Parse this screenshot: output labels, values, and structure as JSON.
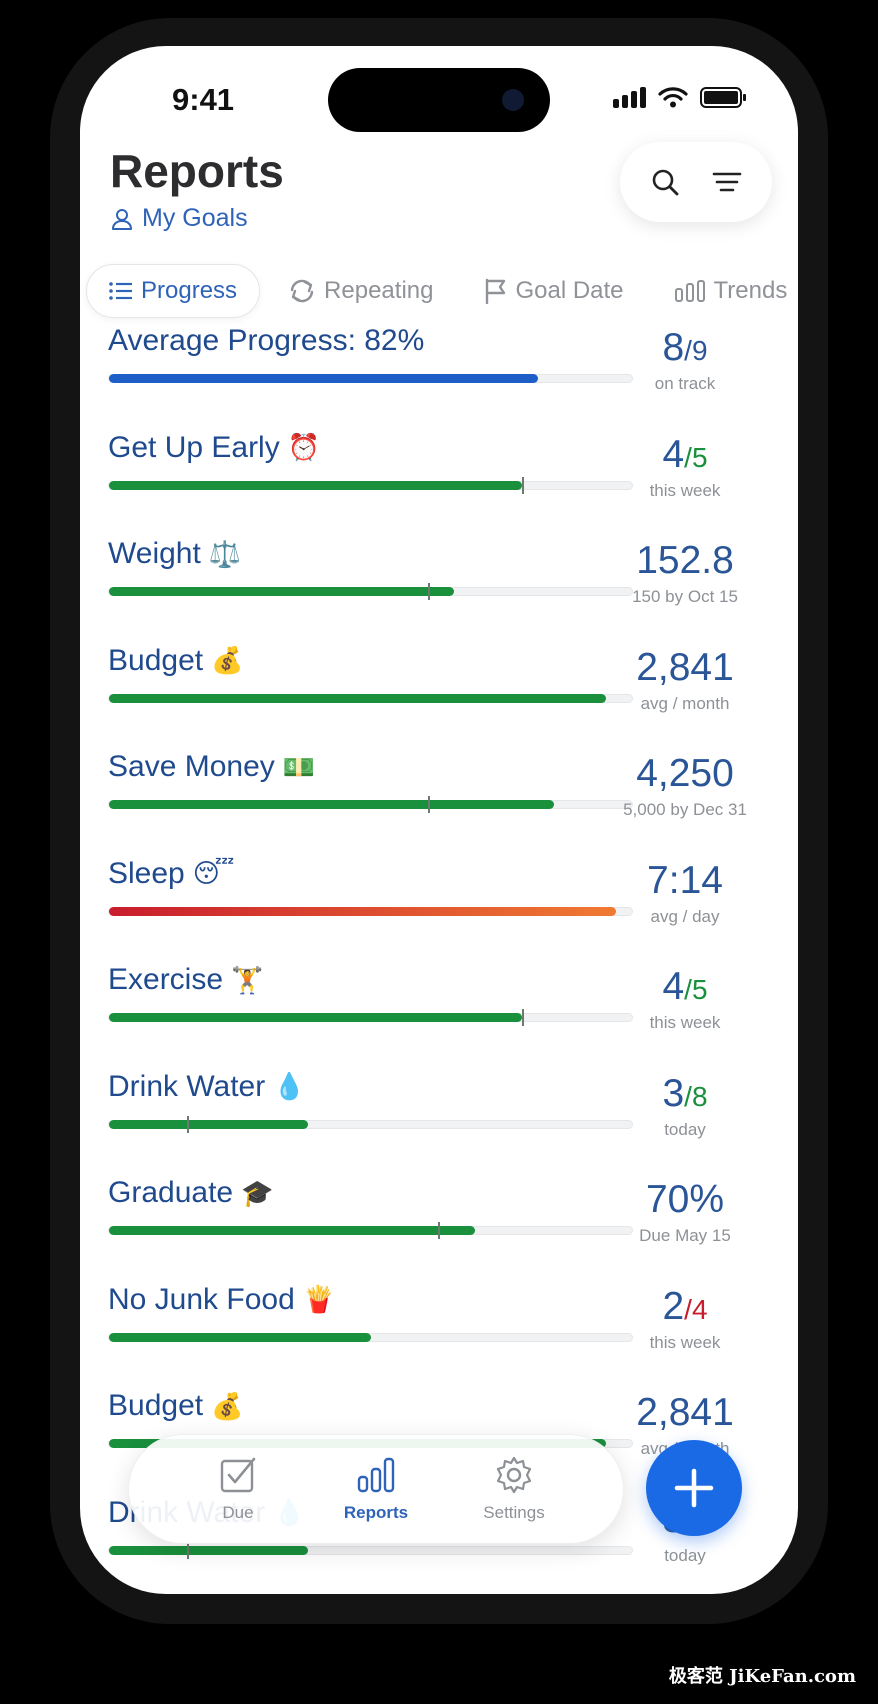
{
  "status": {
    "time": "9:41"
  },
  "header": {
    "title": "Reports",
    "subtitle": "My Goals"
  },
  "tabs": [
    {
      "label": "Progress",
      "icon": "list-icon",
      "active": true
    },
    {
      "label": "Repeating",
      "icon": "repeat-icon",
      "active": false
    },
    {
      "label": "Goal Date",
      "icon": "flag-icon",
      "active": false
    },
    {
      "label": "Trends",
      "icon": "bar-chart-icon",
      "active": false
    }
  ],
  "goals": [
    {
      "name": "Average Progress: 82%",
      "emoji": "",
      "value": "8",
      "denominator": "/9",
      "den_color": "blue",
      "caption": "on track",
      "fill_percent": 82,
      "fill_style": "blue",
      "marker_percent": null
    },
    {
      "name": "Get Up Early",
      "emoji": "⏰",
      "value": "4",
      "denominator": "/5",
      "den_color": "green",
      "caption": "this week",
      "fill_percent": 79,
      "fill_style": "green",
      "marker_percent": 79
    },
    {
      "name": "Weight",
      "emoji": "⚖️",
      "value": "152.8",
      "denominator": "",
      "den_color": "blue",
      "caption": "150 by Oct 15",
      "fill_percent": 66,
      "fill_style": "green",
      "marker_percent": 61
    },
    {
      "name": "Budget",
      "emoji": "💰",
      "value": "2,841",
      "denominator": "",
      "den_color": "blue",
      "caption": "avg / month",
      "fill_percent": 95,
      "fill_style": "green",
      "marker_percent": null
    },
    {
      "name": "Save Money",
      "emoji": "💵",
      "value": "4,250",
      "denominator": "",
      "den_color": "blue",
      "caption": "5,000 by Dec 31",
      "fill_percent": 85,
      "fill_style": "green",
      "marker_percent": 61
    },
    {
      "name": "Sleep",
      "emoji": "😴",
      "value": "7:14",
      "denominator": "",
      "den_color": "blue",
      "caption": "avg / day",
      "fill_percent": 97,
      "fill_style": "red",
      "marker_percent": null
    },
    {
      "name": "Exercise",
      "emoji": "🏋️",
      "value": "4",
      "denominator": "/5",
      "den_color": "green",
      "caption": "this week",
      "fill_percent": 79,
      "fill_style": "green",
      "marker_percent": 79
    },
    {
      "name": "Drink Water",
      "emoji": "💧",
      "value": "3",
      "denominator": "/8",
      "den_color": "green",
      "caption": "today",
      "fill_percent": 38,
      "fill_style": "green",
      "marker_percent": 15
    },
    {
      "name": "Graduate",
      "emoji": "🎓",
      "value": "70%",
      "denominator": "",
      "den_color": "blue",
      "caption": "Due May 15",
      "fill_percent": 70,
      "fill_style": "green",
      "marker_percent": 63
    },
    {
      "name": "No Junk Food",
      "emoji": "🍟",
      "value": "2",
      "denominator": "/4",
      "den_color": "red",
      "caption": "this week",
      "fill_percent": 50,
      "fill_style": "green",
      "marker_percent": null
    },
    {
      "name": "Budget",
      "emoji": "💰",
      "value": "2,841",
      "denominator": "",
      "den_color": "blue",
      "caption": "avg / month",
      "fill_percent": 95,
      "fill_style": "green",
      "marker_percent": null
    },
    {
      "name": "Drink Water",
      "emoji": "💧",
      "value": "3",
      "denominator": "/8",
      "den_color": "green",
      "caption": "today",
      "fill_percent": 38,
      "fill_style": "green",
      "marker_percent": 15
    }
  ],
  "tabbar": {
    "items": [
      {
        "label": "Due",
        "icon": "checkbox-icon",
        "active": false
      },
      {
        "label": "Reports",
        "icon": "bar-chart-icon",
        "active": true
      },
      {
        "label": "Settings",
        "icon": "gear-icon",
        "active": false
      }
    ]
  },
  "fab": {
    "icon": "plus-icon"
  },
  "watermark": "极客范 JiKeFan.com",
  "colors": {
    "accent": "#2e63b8",
    "progress_green": "#1a8f3c",
    "progress_blue": "#1e5fc7",
    "alert_red": "#c81d2d",
    "fab": "#1a6ae6"
  }
}
